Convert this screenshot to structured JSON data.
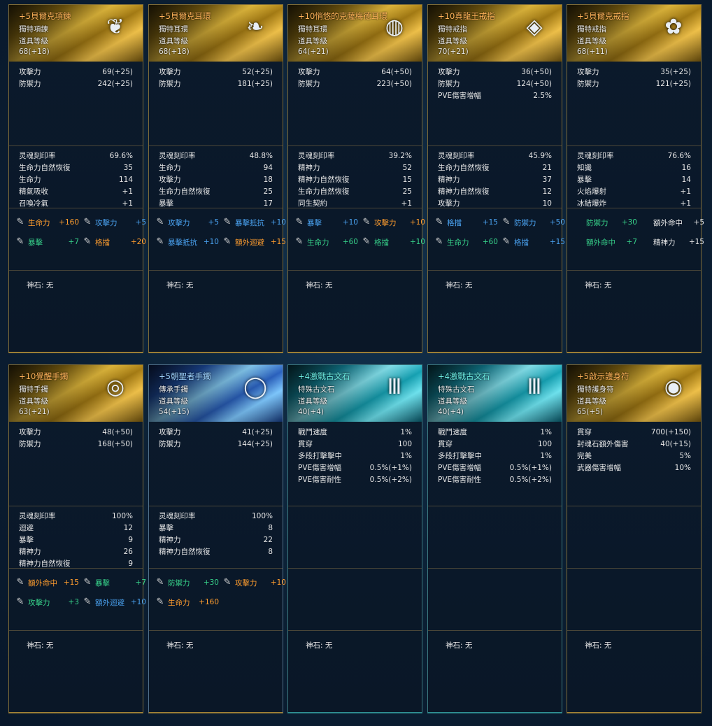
{
  "cards": [
    {
      "title": "+5貝爾克項鍊",
      "style": "gold",
      "icon": "necklace-icon",
      "glyph": "❦",
      "type": "獨特項鍊",
      "level_label": "道具等級",
      "level": "68(+18)",
      "base": [
        [
          "攻擊力",
          "69(+25)"
        ],
        [
          "防禦力",
          "242(+25)"
        ]
      ],
      "extra": [
        [
          "灵魂刻印率",
          "69.6%"
        ],
        [
          "生命力自然恢復",
          "35"
        ],
        [
          "生命力",
          "114"
        ],
        [
          "精氣吸收",
          "+1"
        ],
        [
          "召喚冷氣",
          "+1"
        ]
      ],
      "gems": [
        {
          "name": "生命力",
          "value": "+160",
          "color": "orange"
        },
        {
          "name": "攻擊力",
          "value": "+5",
          "color": "blue-t"
        },
        {
          "name": "暴擊",
          "value": "+7",
          "color": "green"
        },
        {
          "name": "格擋",
          "value": "+20",
          "color": "orange"
        }
      ],
      "gem_icons": true,
      "god_stone": "神石: 无"
    },
    {
      "title": "+5貝爾克耳環",
      "style": "gold",
      "icon": "earring-icon",
      "glyph": "❧",
      "type": "獨特耳環",
      "level_label": "道具等級",
      "level": "68(+18)",
      "base": [
        [
          "攻擊力",
          "52(+25)"
        ],
        [
          "防禦力",
          "181(+25)"
        ]
      ],
      "extra": [
        [
          "灵魂刻印率",
          "48.8%"
        ],
        [
          "生命力",
          "94"
        ],
        [
          "攻擊力",
          "18"
        ],
        [
          "生命力自然恢復",
          "25"
        ],
        [
          "暴擊",
          "17"
        ]
      ],
      "gems": [
        {
          "name": "攻擊力",
          "value": "+5",
          "color": "blue-t"
        },
        {
          "name": "暴擊抵抗",
          "value": "+10",
          "color": "blue-t"
        },
        {
          "name": "暴擊抵抗",
          "value": "+10",
          "color": "blue-t"
        },
        {
          "name": "額外迴避",
          "value": "+15",
          "color": "orange"
        }
      ],
      "gem_icons": true,
      "god_stone": "神石: 无"
    },
    {
      "title": "+10悄悠的克薩梅德耳環",
      "style": "gold",
      "icon": "earring-red-icon",
      "glyph": "◍",
      "type": "獨特耳環",
      "level_label": "道具等級",
      "level": "64(+21)",
      "base": [
        [
          "攻擊力",
          "64(+50)"
        ],
        [
          "防禦力",
          "223(+50)"
        ]
      ],
      "extra": [
        [
          "灵魂刻印率",
          "39.2%"
        ],
        [
          "精神力",
          "52"
        ],
        [
          "精神力自然恢復",
          "15"
        ],
        [
          "生命力自然恢復",
          "25"
        ],
        [
          "同生契約",
          "+1"
        ]
      ],
      "gems": [
        {
          "name": "暴擊",
          "value": "+10",
          "color": "blue-t"
        },
        {
          "name": "攻擊力",
          "value": "+10",
          "color": "orange"
        },
        {
          "name": "生命力",
          "value": "+60",
          "color": "green"
        },
        {
          "name": "格擋",
          "value": "+10",
          "color": "green"
        }
      ],
      "gem_icons": true,
      "god_stone": "神石: 无"
    },
    {
      "title": "+10真龍王戒指",
      "style": "gold",
      "icon": "ring-diamond-icon",
      "glyph": "◈",
      "type": "獨特戒指",
      "level_label": "道具等級",
      "level": "70(+21)",
      "base": [
        [
          "攻擊力",
          "36(+50)"
        ],
        [
          "防禦力",
          "124(+50)"
        ],
        [
          "PVE傷害增幅",
          "2.5%"
        ]
      ],
      "extra": [
        [
          "灵魂刻印率",
          "45.9%"
        ],
        [
          "生命力自然恢復",
          "21"
        ],
        [
          "精神力",
          "37"
        ],
        [
          "精神力自然恢復",
          "12"
        ],
        [
          "攻擊力",
          "10"
        ]
      ],
      "gems": [
        {
          "name": "格擋",
          "value": "+15",
          "color": "blue-t"
        },
        {
          "name": "防禦力",
          "value": "+50",
          "color": "blue-t"
        },
        {
          "name": "生命力",
          "value": "+60",
          "color": "green"
        },
        {
          "name": "格擋",
          "value": "+15",
          "color": "blue-t"
        }
      ],
      "gem_icons": true,
      "god_stone": "神石: 无"
    },
    {
      "title": "+5貝爾克戒指",
      "style": "gold",
      "icon": "ring-emerald-icon",
      "glyph": "✿",
      "type": "獨特戒指",
      "level_label": "道具等級",
      "level": "68(+11)",
      "base": [
        [
          "攻擊力",
          "35(+25)"
        ],
        [
          "防禦力",
          "121(+25)"
        ]
      ],
      "extra": [
        [
          "灵魂刻印率",
          "76.6%"
        ],
        [
          "知識",
          "16"
        ],
        [
          "暴擊",
          "14"
        ],
        [
          "火焰爆射",
          "+1"
        ],
        [
          "冰結爆炸",
          "+1"
        ]
      ],
      "gems": [
        {
          "name": "防禦力",
          "value": "+30",
          "color": "green"
        },
        {
          "name": "額外命中",
          "value": "+5",
          "color": "white"
        },
        {
          "name": "額外命中",
          "value": "+7",
          "color": "green"
        },
        {
          "name": "精神力",
          "value": "+15",
          "color": "white"
        }
      ],
      "gem_icons": false,
      "god_stone": "神石: 无"
    },
    {
      "title": "+10覺醒手鐲",
      "style": "gold",
      "icon": "bracelet-icon",
      "glyph": "◎",
      "type": "獨特手鐲",
      "level_label": "道具等級",
      "level": "63(+21)",
      "base": [
        [
          "攻擊力",
          "48(+50)"
        ],
        [
          "防禦力",
          "168(+50)"
        ]
      ],
      "extra": [
        [
          "灵魂刻印率",
          "100%"
        ],
        [
          "迴避",
          "12"
        ],
        [
          "暴擊",
          "9"
        ],
        [
          "精神力",
          "26"
        ],
        [
          "精神力自然恢復",
          "9"
        ]
      ],
      "gems": [
        {
          "name": "額外命中",
          "value": "+15",
          "color": "orange"
        },
        {
          "name": "暴擊",
          "value": "+7",
          "color": "green"
        },
        {
          "name": "攻擊力",
          "value": "+3",
          "color": "green"
        },
        {
          "name": "額外迴避",
          "value": "+10",
          "color": "blue-t"
        }
      ],
      "gem_icons": true,
      "god_stone": "神石: 无"
    },
    {
      "title": "+5朝聖者手鐲",
      "style": "blue",
      "icon": "bangle-icon",
      "glyph": "◯",
      "type": "傳承手鐲",
      "level_label": "道具等級",
      "level": "54(+15)",
      "base": [
        [
          "攻擊力",
          "41(+25)"
        ],
        [
          "防禦力",
          "144(+25)"
        ]
      ],
      "extra": [
        [
          "灵魂刻印率",
          "100%"
        ],
        [
          "暴擊",
          "8"
        ],
        [
          "精神力",
          "22"
        ],
        [
          "精神力自然恢復",
          "8"
        ]
      ],
      "gems": [
        {
          "name": "防禦力",
          "value": "+30",
          "color": "green"
        },
        {
          "name": "攻擊力",
          "value": "+10",
          "color": "orange"
        },
        {
          "name": "生命力",
          "value": "+160",
          "color": "orange"
        }
      ],
      "gem_icons": true,
      "god_stone": "神石: 无"
    },
    {
      "title": "+4激戰古文石",
      "style": "teal",
      "icon": "rune-stone-icon",
      "glyph": "Ⅲ",
      "type": "特殊古文石",
      "level_label": "道具等級",
      "level": "40(+4)",
      "base": [
        [
          "戰鬥速度",
          "1%"
        ],
        [
          "貫穿",
          "100"
        ],
        [
          "多段打擊擊中",
          "1%"
        ],
        [
          "PVE傷害增幅",
          "0.5%(+1%)"
        ],
        [
          "PVE傷害耐性",
          "0.5%(+2%)"
        ]
      ],
      "extra": [],
      "gems": [],
      "gem_icons": false,
      "god_stone": "神石: 无"
    },
    {
      "title": "+4激戰古文石",
      "style": "teal",
      "icon": "rune-stone-icon",
      "glyph": "Ⅲ",
      "type": "特殊古文石",
      "level_label": "道具等級",
      "level": "40(+4)",
      "base": [
        [
          "戰鬥速度",
          "1%"
        ],
        [
          "貫穿",
          "100"
        ],
        [
          "多段打擊擊中",
          "1%"
        ],
        [
          "PVE傷害增幅",
          "0.5%(+1%)"
        ],
        [
          "PVE傷害耐性",
          "0.5%(+2%)"
        ]
      ],
      "extra": [],
      "gems": [],
      "gem_icons": false,
      "god_stone": "神石: 无"
    },
    {
      "title": "+5啟示護身符",
      "style": "gold",
      "icon": "amulet-icon",
      "glyph": "◉",
      "type": "獨特護身符",
      "level_label": "道具等級",
      "level": "65(+5)",
      "base": [
        [
          "貫穿",
          "700(+150)"
        ],
        [
          "封魂石額外傷害",
          "40(+15)"
        ],
        [
          "完美",
          "5%"
        ],
        [
          "武器傷害增幅",
          "10%"
        ]
      ],
      "extra": [],
      "gems": [],
      "gem_icons": false,
      "god_stone": "神石: 无"
    }
  ]
}
